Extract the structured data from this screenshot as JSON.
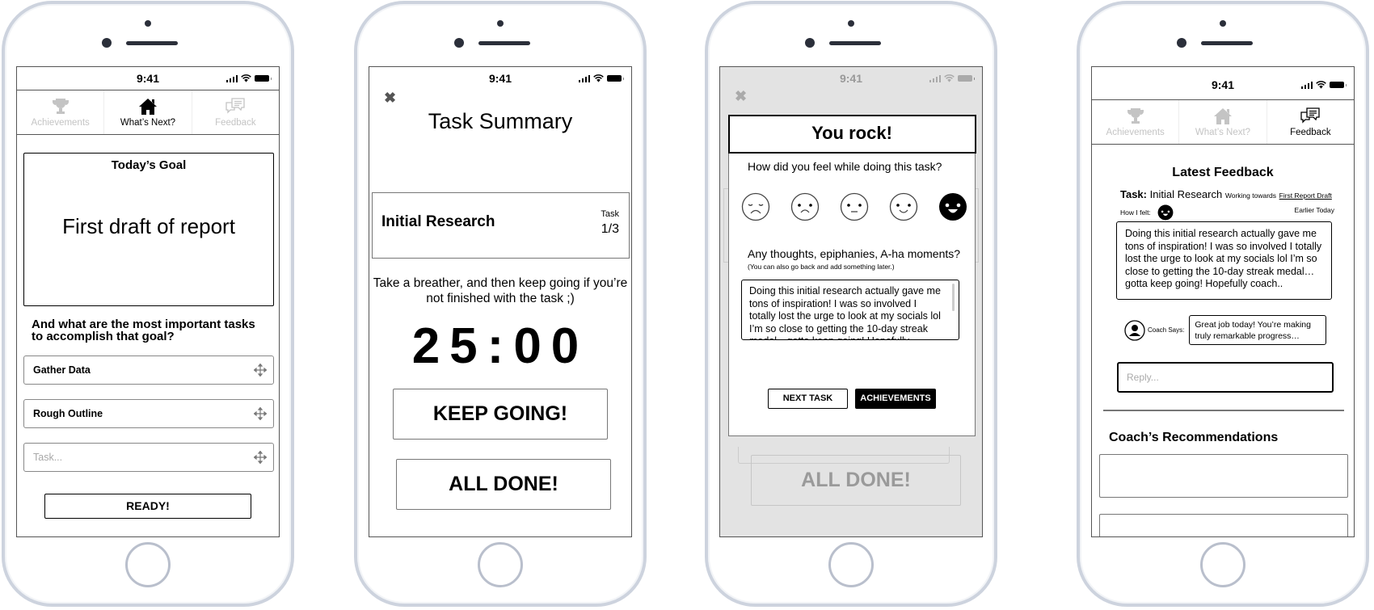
{
  "status_bar": {
    "time": "9:41"
  },
  "tabs": [
    {
      "label": "Achievements",
      "icon": "trophy-icon"
    },
    {
      "label": "What’s Next?",
      "icon": "home-icon"
    },
    {
      "label": "Feedback",
      "icon": "chat-bubbles-icon"
    }
  ],
  "screen1": {
    "active_tab": "What’s Next?",
    "goal_title": "Today’s Goal",
    "goal_text": "First draft of report",
    "question": "And what are the most important tasks to accomplish that goal?",
    "tasks": [
      {
        "value": "Gather Data"
      },
      {
        "value": "Rough Outline"
      }
    ],
    "task_placeholder": "Task...",
    "ready_label": "READY!"
  },
  "screen2": {
    "title": "Task Summary",
    "task_name": "Initial Research",
    "task_label": "Task",
    "task_count": "1/3",
    "message": "Take a breather, and then keep going if you’re not finished with the task ;)",
    "timer": "25:00",
    "keep_going_label": "KEEP GOING!",
    "all_done_label": "ALL DONE!"
  },
  "screen3": {
    "modal_title": "You rock!",
    "feel_question": "How did you feel while doing this task?",
    "moods": [
      "very-sad",
      "sad",
      "neutral",
      "happy",
      "very-happy"
    ],
    "selected_mood": "very-happy",
    "thoughts_question": "Any thoughts, epiphanies, A-ha moments?",
    "thoughts_hint": "(You can also go back and add something later.)",
    "thoughts_value": "Doing this initial research actually gave me tons of inspiration! I was so involved I totally lost the urge to look at my socials lol I’m so close to getting the 10-day streak medal…gotta keep going! Hopefully coach…",
    "next_task_label": "NEXT TASK",
    "achievements_label": "ACHIEVEMENTS",
    "background_button": "ALL DONE!"
  },
  "screen4": {
    "active_tab": "Feedback",
    "title": "Latest Feedback",
    "task_prefix": "Task:",
    "task_name": "Initial Research",
    "working_towards": "Working towards",
    "goal_link": "First Report Draft",
    "felt_label": "How I felt:",
    "felt_mood": "very-happy",
    "time_label": "Earlier Today",
    "entry_text": "Doing this initial research actually gave me tons of inspiration! I was so involved I totally lost the urge to look at my socials lol I’m so close to getting the 10-day streak medal…gotta keep going! Hopefully coach..",
    "coach_label": "Coach Says:",
    "coach_text": "Great job today! You’re making truly remarkable progress…",
    "reply_placeholder": "Reply...",
    "recommendations_title": "Coach’s Recommendations"
  }
}
